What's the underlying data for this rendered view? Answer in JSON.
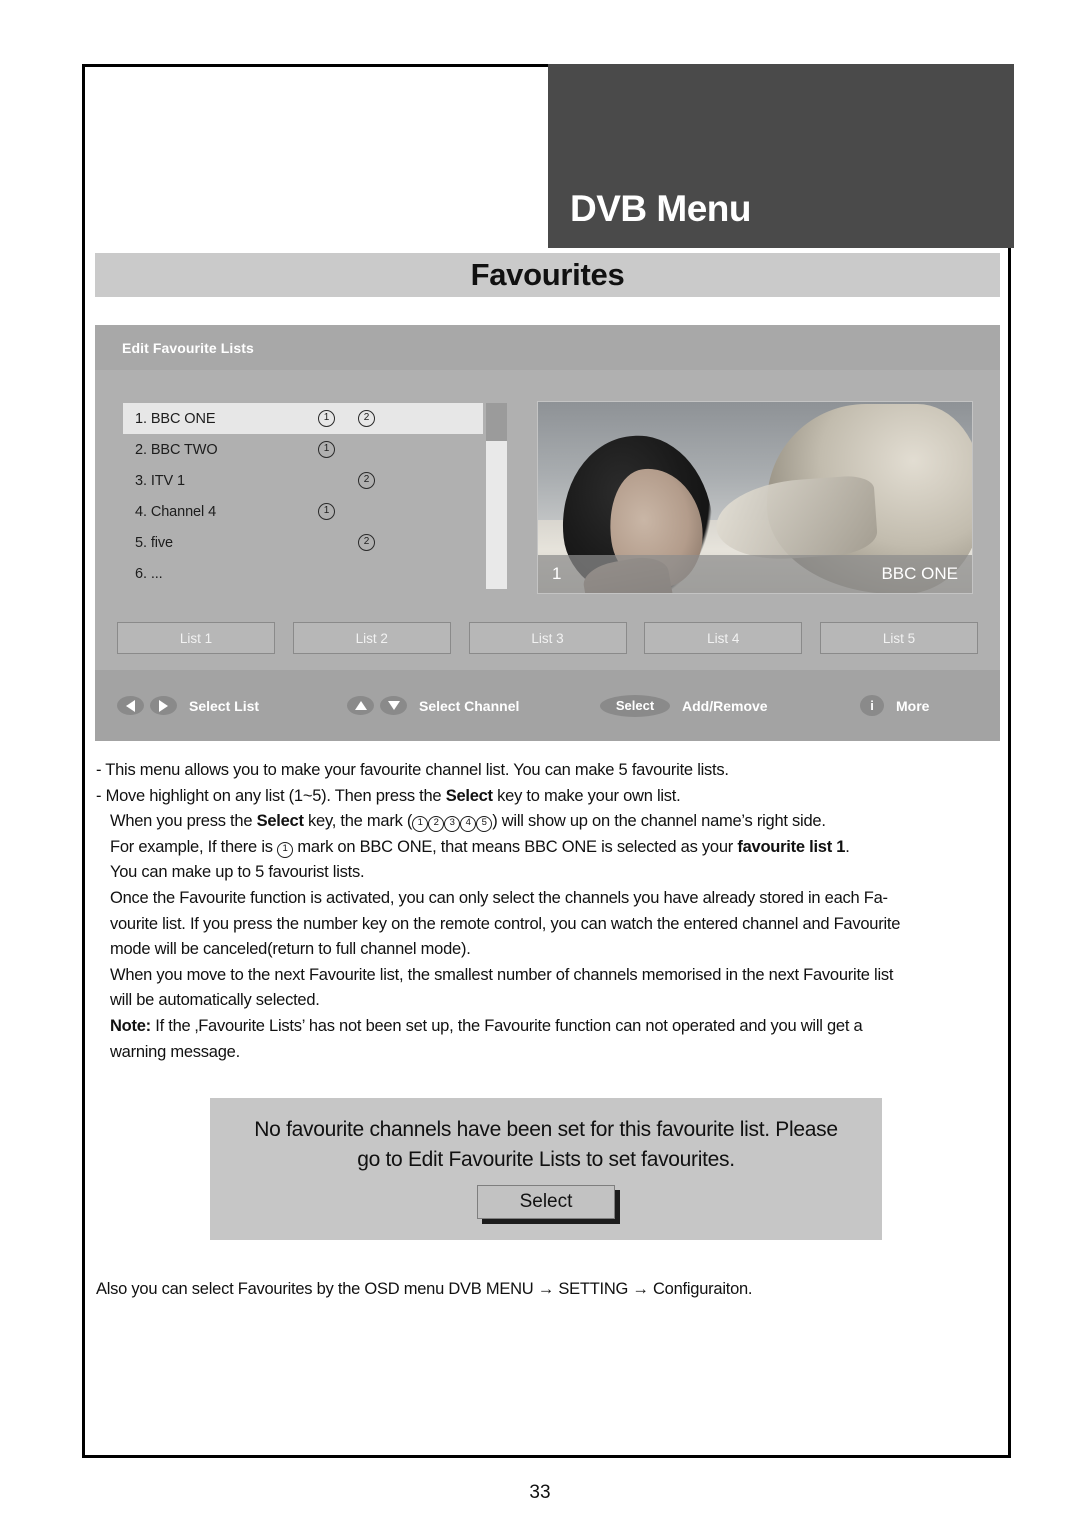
{
  "header": {
    "menu_title": "DVB Menu",
    "section_title": "Favourites"
  },
  "osd": {
    "panel_title": "Edit Favourite Lists",
    "channels": [
      {
        "label": "1. BBC ONE",
        "mark1": "1",
        "mark2": "2",
        "selected": true
      },
      {
        "label": "2. BBC TWO",
        "mark1": "1",
        "mark2": "",
        "selected": false
      },
      {
        "label": "3. ITV 1",
        "mark1": "",
        "mark2": "2",
        "selected": false
      },
      {
        "label": "4. Channel 4",
        "mark1": "1",
        "mark2": "",
        "selected": false
      },
      {
        "label": "5. five",
        "mark1": "",
        "mark2": "2",
        "selected": false
      },
      {
        "label": "6. ...",
        "mark1": "",
        "mark2": "",
        "selected": false
      }
    ],
    "preview": {
      "channel_number": "1",
      "channel_name": "BBC ONE"
    },
    "list_buttons": [
      "List 1",
      "List 2",
      "List 3",
      "List 4",
      "List 5"
    ],
    "nav": [
      {
        "icon": "arrow-left-icon",
        "icon2": "arrow-right-icon",
        "label": "Select List"
      },
      {
        "icon": "arrow-up-icon",
        "icon2": "arrow-down-icon",
        "label": "Select Channel"
      },
      {
        "icon": "select-key-icon",
        "icon_text": "Select",
        "label": "Add/Remove"
      },
      {
        "icon": "info-key-icon",
        "icon_text": "i",
        "label": "More"
      }
    ]
  },
  "body": {
    "l1": "- This menu allows you to make your favourite channel list. You can make 5 favourite lists.",
    "l2_a": "- Move highlight on any list (1~5). Then press the ",
    "l2_b": "Select",
    "l2_c": " key to make your own list.",
    "l3_a": "When you press the ",
    "l3_b": "Select",
    "l3_c": " key, the mark (",
    "l3_d": ") will show up on the channel name’s right side.",
    "l4_a": "For example, If there is ",
    "l4_b": " mark on BBC ONE, that means BBC ONE is selected as your ",
    "l4_c": "favourite list 1",
    "l4_d": ".",
    "l5": "You can make up to 5 favourist lists.",
    "l6": "Once the Favourite function is activated, you can only select the channels you have already stored in each Fa-",
    "l7": "vourite list. If you press the number key on the remote control, you can watch the entered channel and Favourite",
    "l8": "mode will be canceled(return to full channel mode).",
    "l9": "When you move to the next Favourite list, the smallest number of channels memorised in the next Favourite list",
    "l10": "will be automatically selected.",
    "l11_label": "Note:",
    "l11_text": " If the ‚Favourite Lists’ has not been set up, the Favourite function can not operated and you will get a",
    "l12": "warning message.",
    "marks_inline": [
      "1",
      "2",
      "3",
      "4",
      "5"
    ],
    "mark_single": "1"
  },
  "warning": {
    "line1": "No favourite channels have been set for this favourite list. Please",
    "line2": "go to Edit Favourite Lists to set favourites.",
    "button": "Select"
  },
  "footer": {
    "note": "Also you can select Favourites by the OSD menu DVB MENU → SETTING → Configuraiton.",
    "page_number": "33"
  },
  "colors": {
    "header_dark": "#4a4a4a",
    "bar_gray": "#cacaca",
    "osd_gray": "#b0b0b0",
    "nav_gray": "#a3a3a3",
    "warn_gray": "#c6c6c6"
  }
}
